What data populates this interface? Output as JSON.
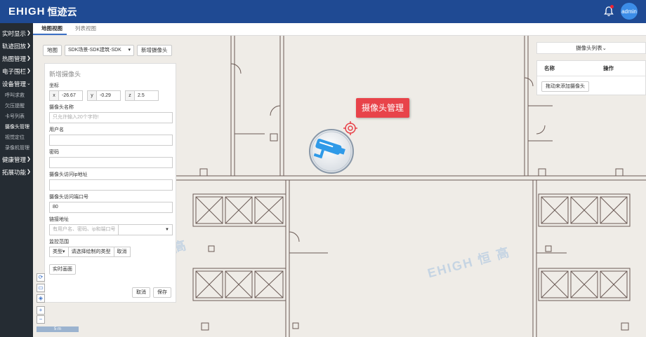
{
  "app": {
    "logo_latin": "EHIGH",
    "logo_cn": "恒迹云",
    "user": "admin"
  },
  "sidebar": {
    "items": [
      {
        "label": "实时显示",
        "arrow": "❯"
      },
      {
        "label": "轨迹回放",
        "arrow": "❯"
      },
      {
        "label": "热图管理",
        "arrow": "❯"
      },
      {
        "label": "电子围栏",
        "arrow": "❯"
      },
      {
        "label": "设备管理",
        "arrow": "⌄"
      }
    ],
    "sub_items": [
      "呼叫求救",
      "欠压提醒",
      "卡号列表",
      "摄像头管理",
      "视觉定位",
      "录像机管理"
    ],
    "items_after": [
      {
        "label": "健康管理",
        "arrow": "❯"
      },
      {
        "label": "拓展功能",
        "arrow": "❯"
      }
    ]
  },
  "tabs": [
    "地图视图",
    "列表视图"
  ],
  "map_toolbar": {
    "map_label": "地图",
    "scene_select": "SDK场景-SDK建筑-SDK",
    "add_camera": "新增摄像头"
  },
  "form": {
    "title": "新增摄像头",
    "coord_label": "坐标",
    "x_prefix": "x",
    "x_value": "-26.67",
    "y_prefix": "y",
    "y_value": "-0.29",
    "z_prefix": "z",
    "z_value": "2.5",
    "name_label": "摄像头名称",
    "name_placeholder": "只允许输入20个字符!",
    "user_label": "用户名",
    "password_label": "密码",
    "ip_label": "摄像头访问ip地址",
    "port_label": "摄像头访问端口号",
    "port_value": "80",
    "link_label": "链接地址",
    "link_placeholder": "有用户名、密码、ip和端口号",
    "scope_label": "监控范围",
    "scope_type": "类型",
    "scope_hint": "请选择绘制的类型",
    "scope_cancel": "取消",
    "realtime_button": "实时画面",
    "cancel_button": "取消",
    "save_button": "保存"
  },
  "camera_tag": "摄像头管理",
  "right_panel": {
    "header": "摄像头列表",
    "col_name": "名称",
    "col_action": "操作",
    "add_button": "拖动来添加摄像头"
  },
  "watermark": "EHIGH 恒 高",
  "map_controls": {
    "scale_label": "5 m"
  },
  "colors": {
    "topbar": "#1f4a93",
    "sidebar": "#252c33",
    "accent": "#3c8de8",
    "tag": "#e8434a"
  }
}
